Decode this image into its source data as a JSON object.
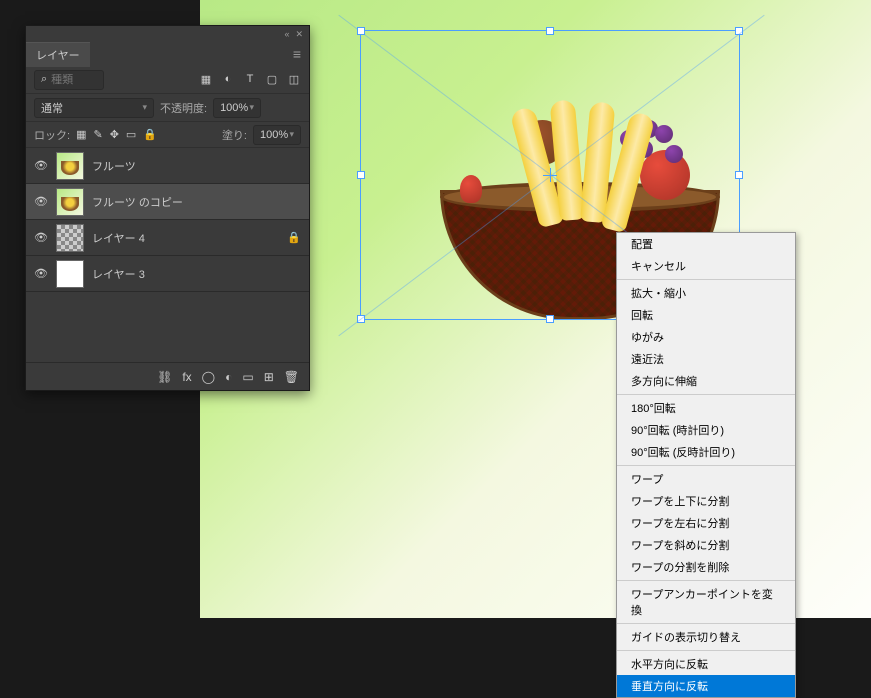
{
  "panel": {
    "tab": "レイヤー",
    "search_placeholder": "種類",
    "blend_mode": "通常",
    "opacity_label": "不透明度:",
    "opacity_value": "100%",
    "lock_label": "ロック:",
    "fill_label": "塗り:",
    "fill_value": "100%"
  },
  "layers": [
    {
      "name": "フルーツ",
      "visible": true,
      "selected": false,
      "thumb": "fruit",
      "locked": false
    },
    {
      "name": "フルーツ のコピー",
      "visible": true,
      "selected": true,
      "thumb": "fruit",
      "locked": false
    },
    {
      "name": "レイヤー 4",
      "visible": true,
      "selected": false,
      "thumb": "checker",
      "locked": true
    },
    {
      "name": "レイヤー 3",
      "visible": true,
      "selected": false,
      "thumb": "white",
      "locked": false
    }
  ],
  "context_menu": {
    "groups": [
      [
        "配置",
        "キャンセル"
      ],
      [
        "拡大・縮小",
        "回転",
        "ゆがみ",
        "遠近法",
        "多方向に伸縮"
      ],
      [
        "180°回転",
        "90°回転 (時計回り)",
        "90°回転 (反時計回り)"
      ],
      [
        "ワープ",
        "ワープを上下に分割",
        "ワープを左右に分割",
        "ワープを斜めに分割",
        "ワープの分割を削除"
      ],
      [
        "ワープアンカーポイントを変換"
      ],
      [
        "ガイドの表示切り替え"
      ],
      [
        "水平方向に反転",
        "垂直方向に反転"
      ]
    ],
    "highlighted": "垂直方向に反転"
  }
}
